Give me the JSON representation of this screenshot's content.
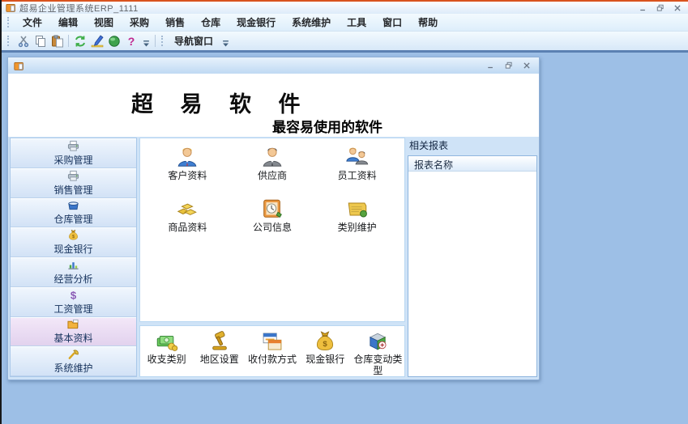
{
  "colors": {
    "titlebar_accent": "#d9531e",
    "mdi_background": "#9dbfe6",
    "sidebar_selected_top": "#f3e7f8",
    "sidebar_selected_bottom": "#e2d2ee"
  },
  "window": {
    "title": "超易企业管理系统ERP_1111",
    "icon": "app-icon",
    "controls": [
      {
        "icon": "minimize-icon"
      },
      {
        "icon": "restore-icon"
      },
      {
        "icon": "close-icon"
      }
    ]
  },
  "menu": {
    "items": [
      "文件",
      "编辑",
      "视图",
      "采购",
      "销售",
      "仓库",
      "现金银行",
      "系统维护",
      "工具",
      "窗口",
      "帮助"
    ]
  },
  "toolbar": {
    "buttons": [
      {
        "icon": "cut-icon"
      },
      {
        "icon": "copy-icon"
      },
      {
        "icon": "paste-icon"
      },
      {
        "icon": "exchange-icon"
      },
      {
        "icon": "pen-icon"
      },
      {
        "icon": "globe-icon"
      },
      {
        "icon": "help-icon"
      }
    ],
    "overflow_icon": "toolbar-overflow-icon",
    "nav_window": {
      "label": "导航窗口",
      "overflow_icon": "toolbar-overflow-icon"
    }
  },
  "inner_window": {
    "icon": "app-icon",
    "controls": [
      {
        "icon": "minimize-icon"
      },
      {
        "icon": "restore-icon"
      },
      {
        "icon": "close-icon"
      }
    ],
    "banner": {
      "title": "超 易 软 件",
      "subtitle": "最容易使用的软件"
    }
  },
  "sidebar": {
    "items": [
      {
        "label": "采购管理",
        "icon": "printer-icon",
        "selected": false
      },
      {
        "label": "销售管理",
        "icon": "printer-icon",
        "selected": false
      },
      {
        "label": "仓库管理",
        "icon": "storage-box-icon",
        "selected": false
      },
      {
        "label": "现金银行",
        "icon": "money-bag-icon",
        "selected": false
      },
      {
        "label": "经营分析",
        "icon": "bar-chart-icon",
        "selected": false
      },
      {
        "label": "工资管理",
        "icon": "dollar-icon",
        "selected": false
      },
      {
        "label": "基本资料",
        "icon": "folder-icon",
        "selected": true
      },
      {
        "label": "系统维护",
        "icon": "wrench-icon",
        "selected": false
      }
    ]
  },
  "shortcuts": {
    "top": [
      {
        "label": "客户资料",
        "icon": "person-blue-icon"
      },
      {
        "label": "供应商",
        "icon": "person-gray-icon"
      },
      {
        "label": "员工资料",
        "icon": "people-icon"
      },
      {
        "label": "商品资料",
        "icon": "gold-bars-icon"
      },
      {
        "label": "公司信息",
        "icon": "address-book-icon"
      },
      {
        "label": "类别维护",
        "icon": "notebook-icon"
      }
    ],
    "bottom": [
      {
        "label": "收支类别",
        "icon": "money-notes-icon"
      },
      {
        "label": "地区设置",
        "icon": "gavel-icon"
      },
      {
        "label": "收付款方式",
        "icon": "payment-cards-icon"
      },
      {
        "label": "现金银行",
        "icon": "money-bag-icon"
      },
      {
        "label": "仓库变动类型",
        "icon": "color-box-icon"
      }
    ]
  },
  "right_panel": {
    "title": "相关报表",
    "list_header": "报表名称"
  }
}
